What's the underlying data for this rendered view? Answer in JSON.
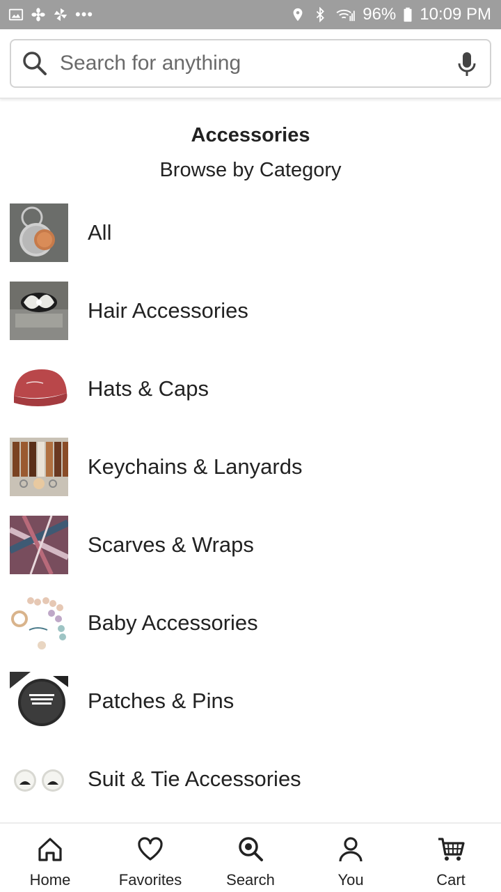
{
  "status_bar": {
    "battery": "96%",
    "time": "10:09 PM",
    "overflow": "•••",
    "left_icons": [
      "gallery-icon",
      "fan-icon",
      "pinwheel-icon"
    ],
    "right_icons": [
      "location-icon",
      "bluetooth-icon",
      "wifi-icon",
      "signal-icon",
      "battery-icon"
    ]
  },
  "search": {
    "placeholder": "Search for anything",
    "left_icon": "search-icon",
    "right_icon": "microphone-icon"
  },
  "page": {
    "title": "Accessories",
    "subtitle": "Browse by Category"
  },
  "categories": [
    {
      "label": "All",
      "thumbnail": "keychain-coin-image"
    },
    {
      "label": "Hair Accessories",
      "thumbnail": "hair-comb-image"
    },
    {
      "label": "Hats & Caps",
      "thumbnail": "red-cap-image"
    },
    {
      "label": "Keychains & Lanyards",
      "thumbnail": "leather-keychains-image"
    },
    {
      "label": "Scarves & Wraps",
      "thumbnail": "plaid-scarf-image"
    },
    {
      "label": "Baby Accessories",
      "thumbnail": "teething-beads-image"
    },
    {
      "label": "Patches & Pins",
      "thumbnail": "button-pin-image"
    },
    {
      "label": "Suit & Tie Accessories",
      "thumbnail": "cufflinks-image"
    }
  ],
  "bottom_nav": [
    {
      "label": "Home",
      "icon": "home-icon"
    },
    {
      "label": "Favorites",
      "icon": "heart-icon"
    },
    {
      "label": "Search",
      "icon": "search-icon"
    },
    {
      "label": "You",
      "icon": "user-icon"
    },
    {
      "label": "Cart",
      "icon": "cart-icon"
    }
  ],
  "colors": {
    "status_bar_bg": "#9e9e9e",
    "text": "#222222",
    "border": "#d3d3d3"
  }
}
